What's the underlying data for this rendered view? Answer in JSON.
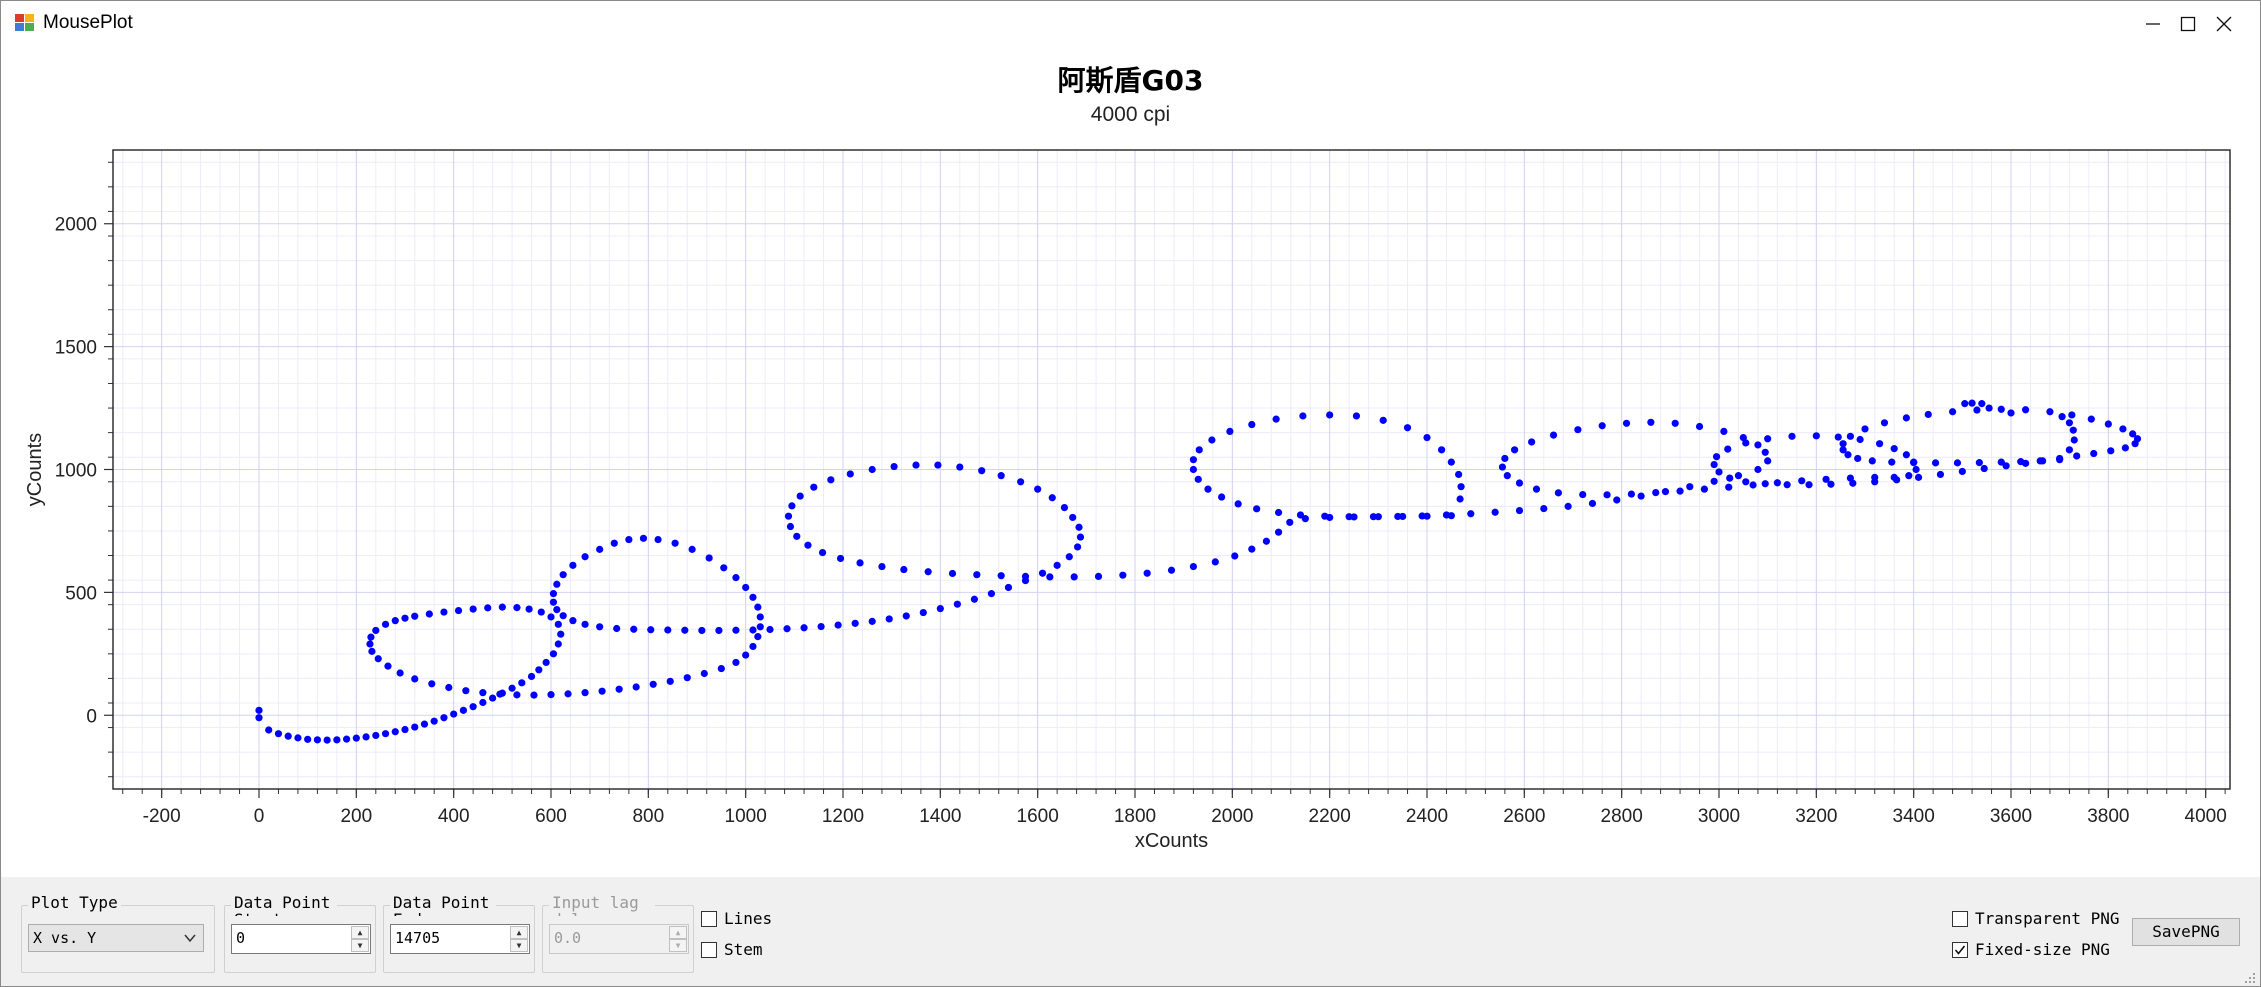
{
  "window": {
    "title": "MousePlot"
  },
  "chart_data": {
    "type": "scatter",
    "title": "阿斯盾G03",
    "subtitle": "4000 cpi",
    "xlabel": "xCounts",
    "ylabel": "yCounts",
    "xlim": [
      -300,
      4050
    ],
    "ylim": [
      -300,
      2300
    ],
    "xticks": [
      -200,
      0,
      200,
      400,
      600,
      800,
      1000,
      1200,
      1400,
      1600,
      1800,
      2000,
      2200,
      2400,
      2600,
      2800,
      3000,
      3200,
      3400,
      3600,
      3800,
      4000
    ],
    "xtick_labels": [
      "-200",
      "0",
      "200",
      "400",
      "600",
      "800",
      "1000",
      "1200",
      "1400",
      "1600",
      "1800",
      "2000",
      "2200",
      "2400",
      "2600",
      "2800",
      "3000",
      "3200",
      "3400",
      "3600",
      "3800",
      "4000"
    ],
    "yticks": [
      0,
      500,
      1000,
      1500,
      2000
    ],
    "ytick_labels": [
      "0",
      "500",
      "1000",
      "1500",
      "2000"
    ],
    "grid": true,
    "marker_color": "#0000ff",
    "points": [
      [
        0,
        20
      ],
      [
        0,
        -10
      ],
      [
        20,
        -60
      ],
      [
        40,
        -75
      ],
      [
        60,
        -85
      ],
      [
        80,
        -92
      ],
      [
        100,
        -98
      ],
      [
        120,
        -100
      ],
      [
        140,
        -101
      ],
      [
        160,
        -100
      ],
      [
        180,
        -97
      ],
      [
        200,
        -93
      ],
      [
        220,
        -88
      ],
      [
        240,
        -82
      ],
      [
        260,
        -75
      ],
      [
        280,
        -67
      ],
      [
        300,
        -58
      ],
      [
        320,
        -48
      ],
      [
        340,
        -36
      ],
      [
        360,
        -24
      ],
      [
        380,
        -10
      ],
      [
        400,
        5
      ],
      [
        420,
        20
      ],
      [
        440,
        35
      ],
      [
        460,
        52
      ],
      [
        480,
        70
      ],
      [
        500,
        90
      ],
      [
        520,
        110
      ],
      [
        540,
        132
      ],
      [
        560,
        158
      ],
      [
        575,
        185
      ],
      [
        590,
        215
      ],
      [
        605,
        250
      ],
      [
        615,
        290
      ],
      [
        620,
        330
      ],
      [
        615,
        370
      ],
      [
        600,
        400
      ],
      [
        580,
        420
      ],
      [
        555,
        432
      ],
      [
        530,
        438
      ],
      [
        500,
        440
      ],
      [
        470,
        437
      ],
      [
        440,
        432
      ],
      [
        410,
        426
      ],
      [
        380,
        420
      ],
      [
        350,
        412
      ],
      [
        320,
        403
      ],
      [
        300,
        395
      ],
      [
        280,
        385
      ],
      [
        260,
        370
      ],
      [
        240,
        345
      ],
      [
        230,
        318
      ],
      [
        228,
        290
      ],
      [
        232,
        260
      ],
      [
        245,
        230
      ],
      [
        265,
        200
      ],
      [
        290,
        172
      ],
      [
        320,
        148
      ],
      [
        355,
        128
      ],
      [
        390,
        113
      ],
      [
        425,
        100
      ],
      [
        460,
        92
      ],
      [
        495,
        86
      ],
      [
        530,
        83
      ],
      [
        565,
        82
      ],
      [
        600,
        84
      ],
      [
        635,
        87
      ],
      [
        670,
        92
      ],
      [
        705,
        98
      ],
      [
        740,
        106
      ],
      [
        775,
        115
      ],
      [
        810,
        126
      ],
      [
        845,
        138
      ],
      [
        880,
        153
      ],
      [
        915,
        170
      ],
      [
        950,
        190
      ],
      [
        980,
        215
      ],
      [
        1000,
        245
      ],
      [
        1015,
        280
      ],
      [
        1025,
        320
      ],
      [
        1030,
        360
      ],
      [
        1030,
        400
      ],
      [
        1025,
        440
      ],
      [
        1015,
        480
      ],
      [
        1000,
        520
      ],
      [
        980,
        560
      ],
      [
        955,
        600
      ],
      [
        925,
        640
      ],
      [
        890,
        675
      ],
      [
        855,
        700
      ],
      [
        820,
        715
      ],
      [
        790,
        720
      ],
      [
        760,
        715
      ],
      [
        730,
        700
      ],
      [
        700,
        675
      ],
      [
        670,
        645
      ],
      [
        645,
        610
      ],
      [
        625,
        572
      ],
      [
        612,
        533
      ],
      [
        605,
        495
      ],
      [
        605,
        460
      ],
      [
        612,
        430
      ],
      [
        625,
        405
      ],
      [
        645,
        385
      ],
      [
        670,
        370
      ],
      [
        700,
        360
      ],
      [
        735,
        353
      ],
      [
        770,
        350
      ],
      [
        805,
        348
      ],
      [
        840,
        347
      ],
      [
        875,
        346
      ],
      [
        910,
        345
      ],
      [
        945,
        345
      ],
      [
        980,
        346
      ],
      [
        1015,
        347
      ],
      [
        1050,
        349
      ],
      [
        1085,
        352
      ],
      [
        1120,
        356
      ],
      [
        1155,
        361
      ],
      [
        1190,
        367
      ],
      [
        1225,
        374
      ],
      [
        1260,
        382
      ],
      [
        1295,
        392
      ],
      [
        1330,
        404
      ],
      [
        1365,
        418
      ],
      [
        1400,
        434
      ],
      [
        1435,
        452
      ],
      [
        1470,
        472
      ],
      [
        1505,
        495
      ],
      [
        1540,
        520
      ],
      [
        1575,
        548
      ],
      [
        1610,
        578
      ],
      [
        1640,
        610
      ],
      [
        1665,
        645
      ],
      [
        1682,
        685
      ],
      [
        1688,
        725
      ],
      [
        1685,
        765
      ],
      [
        1672,
        805
      ],
      [
        1655,
        845
      ],
      [
        1630,
        885
      ],
      [
        1600,
        920
      ],
      [
        1565,
        950
      ],
      [
        1525,
        975
      ],
      [
        1485,
        995
      ],
      [
        1440,
        1010
      ],
      [
        1395,
        1018
      ],
      [
        1350,
        1018
      ],
      [
        1305,
        1012
      ],
      [
        1260,
        1000
      ],
      [
        1215,
        982
      ],
      [
        1175,
        958
      ],
      [
        1140,
        928
      ],
      [
        1112,
        892
      ],
      [
        1095,
        852
      ],
      [
        1088,
        810
      ],
      [
        1092,
        768
      ],
      [
        1105,
        728
      ],
      [
        1128,
        692
      ],
      [
        1158,
        662
      ],
      [
        1195,
        638
      ],
      [
        1235,
        620
      ],
      [
        1280,
        605
      ],
      [
        1325,
        593
      ],
      [
        1375,
        584
      ],
      [
        1425,
        577
      ],
      [
        1475,
        572
      ],
      [
        1525,
        568
      ],
      [
        1575,
        565
      ],
      [
        1625,
        563
      ],
      [
        1675,
        563
      ],
      [
        1725,
        565
      ],
      [
        1775,
        570
      ],
      [
        1825,
        578
      ],
      [
        1875,
        590
      ],
      [
        1920,
        605
      ],
      [
        1965,
        624
      ],
      [
        2005,
        648
      ],
      [
        2040,
        676
      ],
      [
        2070,
        708
      ],
      [
        2095,
        745
      ],
      [
        2118,
        785
      ],
      [
        2150,
        800
      ],
      [
        2200,
        805
      ],
      [
        2250,
        807
      ],
      [
        2300,
        808
      ],
      [
        2350,
        809
      ],
      [
        2400,
        810
      ],
      [
        2450,
        812
      ],
      [
        2468,
        880
      ],
      [
        2470,
        930
      ],
      [
        2465,
        980
      ],
      [
        2450,
        1030
      ],
      [
        2430,
        1080
      ],
      [
        2400,
        1130
      ],
      [
        2360,
        1170
      ],
      [
        2310,
        1200
      ],
      [
        2255,
        1218
      ],
      [
        2200,
        1222
      ],
      [
        2145,
        1218
      ],
      [
        2090,
        1205
      ],
      [
        2040,
        1183
      ],
      [
        1995,
        1155
      ],
      [
        1958,
        1120
      ],
      [
        1932,
        1080
      ],
      [
        1920,
        1040
      ],
      [
        1920,
        1000
      ],
      [
        1930,
        960
      ],
      [
        1950,
        920
      ],
      [
        1978,
        888
      ],
      [
        2012,
        860
      ],
      [
        2050,
        840
      ],
      [
        2095,
        825
      ],
      [
        2140,
        815
      ],
      [
        2190,
        810
      ],
      [
        2240,
        808
      ],
      [
        2290,
        808
      ],
      [
        2340,
        809
      ],
      [
        2390,
        811
      ],
      [
        2440,
        815
      ],
      [
        2490,
        820
      ],
      [
        2540,
        826
      ],
      [
        2590,
        833
      ],
      [
        2640,
        841
      ],
      [
        2690,
        850
      ],
      [
        2740,
        862
      ],
      [
        2790,
        876
      ],
      [
        2840,
        892
      ],
      [
        2890,
        910
      ],
      [
        2940,
        930
      ],
      [
        2990,
        952
      ],
      [
        3040,
        975
      ],
      [
        3080,
        1000
      ],
      [
        3100,
        1035
      ],
      [
        3095,
        1070
      ],
      [
        3080,
        1100
      ],
      [
        3050,
        1130
      ],
      [
        3010,
        1155
      ],
      [
        2960,
        1175
      ],
      [
        2910,
        1188
      ],
      [
        2860,
        1192
      ],
      [
        2810,
        1188
      ],
      [
        2760,
        1178
      ],
      [
        2710,
        1162
      ],
      [
        2660,
        1140
      ],
      [
        2615,
        1112
      ],
      [
        2580,
        1080
      ],
      [
        2560,
        1045
      ],
      [
        2555,
        1010
      ],
      [
        2565,
        975
      ],
      [
        2590,
        945
      ],
      [
        2625,
        920
      ],
      [
        2670,
        905
      ],
      [
        2720,
        898
      ],
      [
        2770,
        897
      ],
      [
        2820,
        900
      ],
      [
        2870,
        906
      ],
      [
        2920,
        912
      ],
      [
        2970,
        920
      ],
      [
        3020,
        928
      ],
      [
        3070,
        937
      ],
      [
        3120,
        946
      ],
      [
        3170,
        954
      ],
      [
        3220,
        960
      ],
      [
        3270,
        965
      ],
      [
        3320,
        968
      ],
      [
        3360,
        968
      ],
      [
        3390,
        975
      ],
      [
        3405,
        1000
      ],
      [
        3400,
        1030
      ],
      [
        3385,
        1060
      ],
      [
        3360,
        1085
      ],
      [
        3330,
        1105
      ],
      [
        3290,
        1122
      ],
      [
        3245,
        1132
      ],
      [
        3200,
        1137
      ],
      [
        3150,
        1135
      ],
      [
        3100,
        1125
      ],
      [
        3055,
        1108
      ],
      [
        3018,
        1083
      ],
      [
        2995,
        1052
      ],
      [
        2990,
        1020
      ],
      [
        3000,
        990
      ],
      [
        3022,
        965
      ],
      [
        3055,
        950
      ],
      [
        3095,
        942
      ],
      [
        3140,
        938
      ],
      [
        3185,
        938
      ],
      [
        3230,
        940
      ],
      [
        3275,
        944
      ],
      [
        3320,
        950
      ],
      [
        3365,
        958
      ],
      [
        3410,
        968
      ],
      [
        3455,
        980
      ],
      [
        3500,
        992
      ],
      [
        3545,
        1004
      ],
      [
        3590,
        1015
      ],
      [
        3630,
        1025
      ],
      [
        3665,
        1035
      ],
      [
        3700,
        1045
      ],
      [
        3735,
        1055
      ],
      [
        3770,
        1065
      ],
      [
        3805,
        1076
      ],
      [
        3835,
        1088
      ],
      [
        3855,
        1105
      ],
      [
        3860,
        1125
      ],
      [
        3850,
        1145
      ],
      [
        3830,
        1165
      ],
      [
        3800,
        1185
      ],
      [
        3765,
        1205
      ],
      [
        3725,
        1222
      ],
      [
        3680,
        1235
      ],
      [
        3630,
        1243
      ],
      [
        3580,
        1245
      ],
      [
        3530,
        1242
      ],
      [
        3480,
        1235
      ],
      [
        3430,
        1224
      ],
      [
        3385,
        1210
      ],
      [
        3340,
        1190
      ],
      [
        3300,
        1165
      ],
      [
        3270,
        1135
      ],
      [
        3255,
        1105
      ],
      [
        3255,
        1080
      ],
      [
        3265,
        1060
      ],
      [
        3285,
        1045
      ],
      [
        3315,
        1035
      ],
      [
        3355,
        1030
      ],
      [
        3400,
        1028
      ],
      [
        3445,
        1027
      ],
      [
        3490,
        1027
      ],
      [
        3535,
        1028
      ],
      [
        3580,
        1030
      ],
      [
        3620,
        1032
      ],
      [
        3660,
        1035
      ],
      [
        3700,
        1040
      ],
      [
        3720,
        1080
      ],
      [
        3730,
        1120
      ],
      [
        3728,
        1160
      ],
      [
        3720,
        1190
      ],
      [
        3705,
        1215
      ],
      [
        3600,
        1230
      ],
      [
        3555,
        1250
      ],
      [
        3540,
        1268
      ],
      [
        3520,
        1270
      ],
      [
        3505,
        1268
      ]
    ]
  },
  "controls": {
    "plot_type": {
      "label": "Plot Type",
      "value": "X vs. Y"
    },
    "start": {
      "label": "Data Point Start",
      "value": "0"
    },
    "end": {
      "label": "Data Point End",
      "value": "14705"
    },
    "lag": {
      "label": "Input lag delay",
      "value": "0.0"
    },
    "lines": {
      "label": "Lines",
      "checked": false
    },
    "stem": {
      "label": "Stem",
      "checked": false
    },
    "transparent_png": {
      "label": "Transparent PNG",
      "checked": false
    },
    "fixed_size_png": {
      "label": "Fixed-size PNG",
      "checked": true
    },
    "save_button": "SavePNG"
  }
}
